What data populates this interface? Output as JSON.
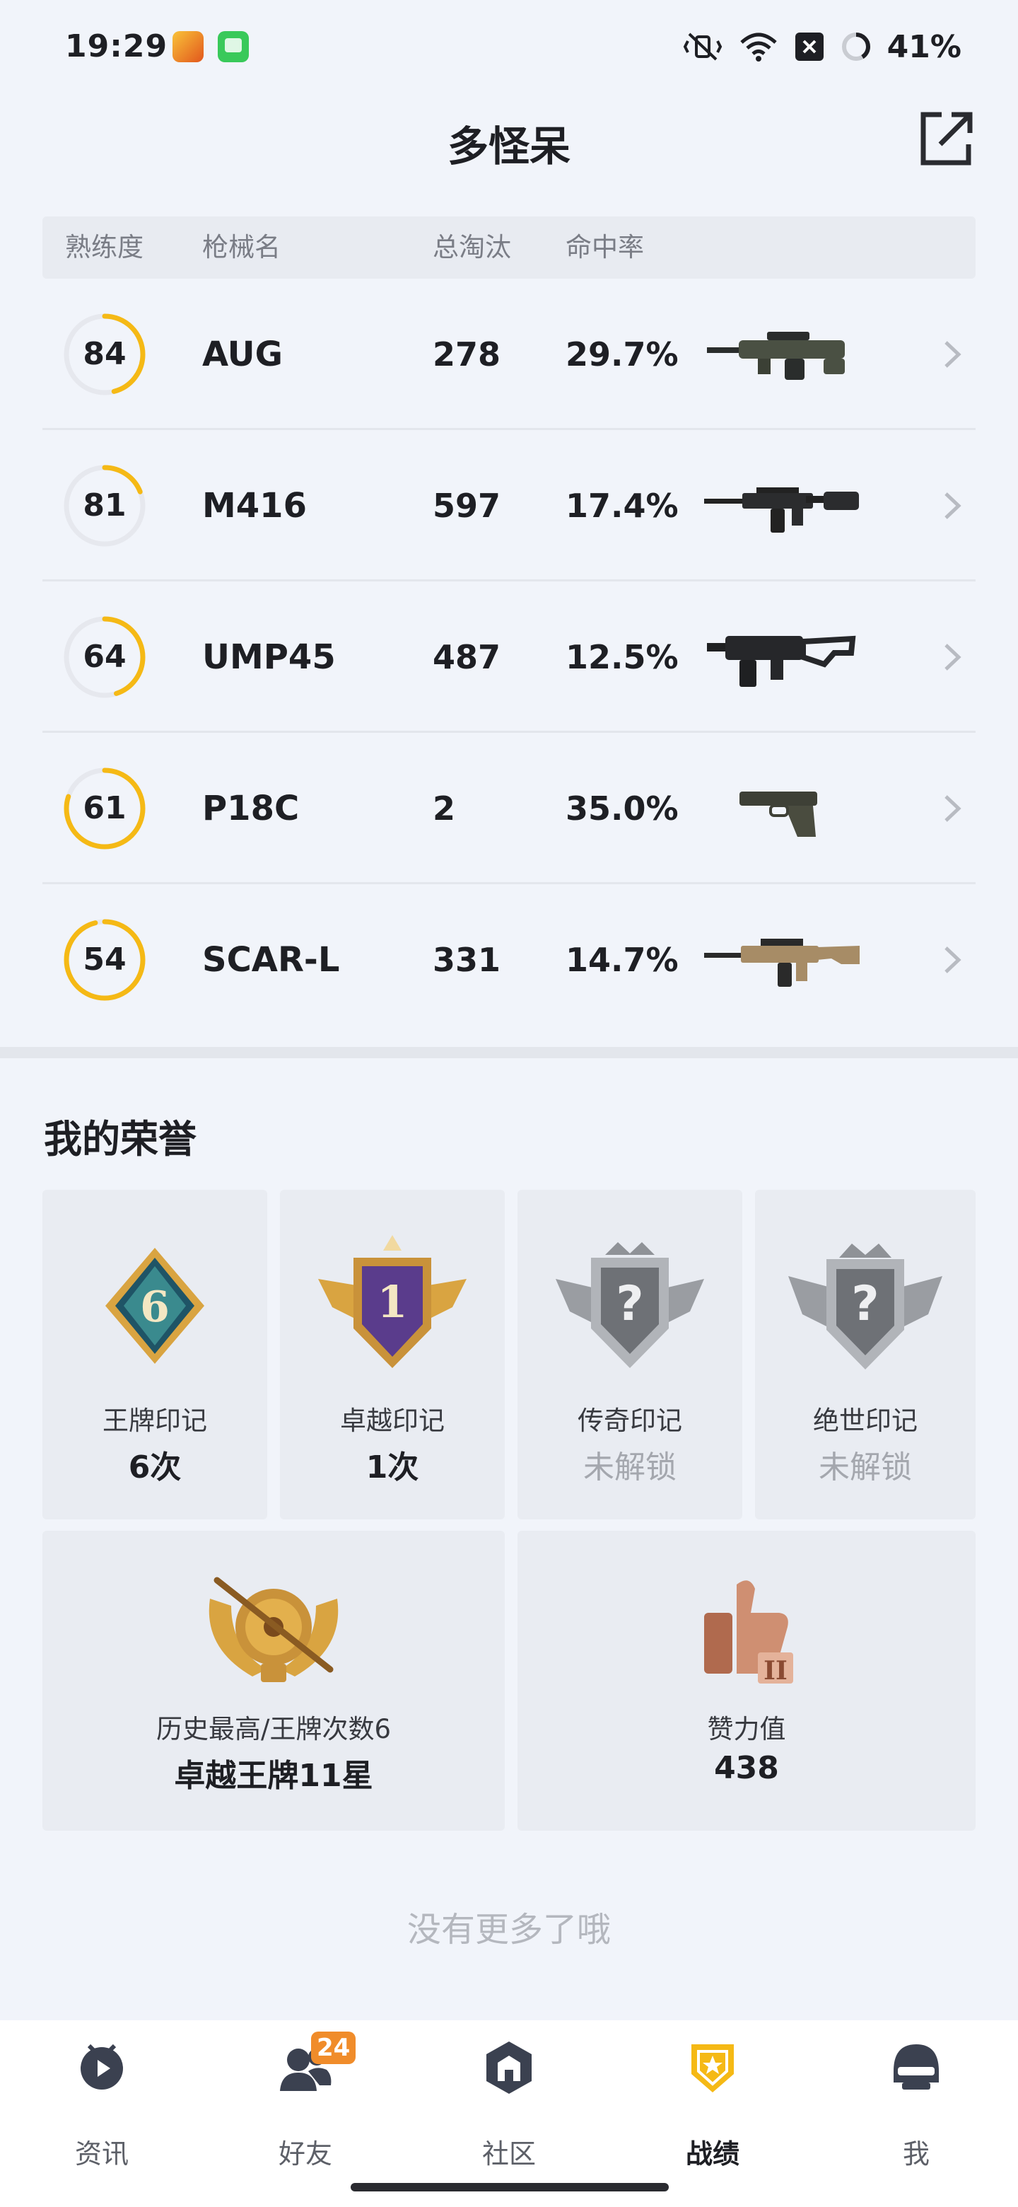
{
  "status_bar": {
    "time": "19:29",
    "battery": "41%"
  },
  "header": {
    "title": "多怪呆"
  },
  "weapon_table": {
    "columns": {
      "mastery": "熟练度",
      "name": "枪械名",
      "kills": "总淘汰",
      "accuracy": "命中率"
    },
    "rows": [
      {
        "mastery": "84",
        "progress": 0.46,
        "name": "AUG",
        "kills": "278",
        "accuracy": "29.7%"
      },
      {
        "mastery": "81",
        "progress": 0.19,
        "name": "M416",
        "kills": "597",
        "accuracy": "17.4%"
      },
      {
        "mastery": "64",
        "progress": 0.45,
        "name": "UMP45",
        "kills": "487",
        "accuracy": "12.5%"
      },
      {
        "mastery": "61",
        "progress": 0.8,
        "name": "P18C",
        "kills": "2",
        "accuracy": "35.0%"
      },
      {
        "mastery": "54",
        "progress": 0.96,
        "name": "SCAR-L",
        "kills": "331",
        "accuracy": "14.7%"
      }
    ]
  },
  "honors": {
    "title": "我的荣誉",
    "badges": [
      {
        "label": "王牌印记",
        "value": "6次",
        "badge_number": "6"
      },
      {
        "label": "卓越印记",
        "value": "1次",
        "badge_number": "1"
      },
      {
        "label": "传奇印记",
        "value": "未解锁"
      },
      {
        "label": "绝世印记",
        "value": "未解锁"
      }
    ],
    "best_rank": {
      "label": "历史最高/王牌次数6",
      "value": "卓越王牌11星"
    },
    "likes": {
      "label": "赞力值",
      "value": "438"
    }
  },
  "footer": {
    "no_more": "没有更多了哦"
  },
  "bottom_nav": {
    "items": [
      {
        "label": "资讯"
      },
      {
        "label": "好友",
        "badge": "24"
      },
      {
        "label": "社区"
      },
      {
        "label": "战绩"
      },
      {
        "label": "我"
      }
    ]
  },
  "colors": {
    "accent": "#f5b915",
    "ring_track": "#e6e8ee",
    "badge": "#f08c2a"
  }
}
